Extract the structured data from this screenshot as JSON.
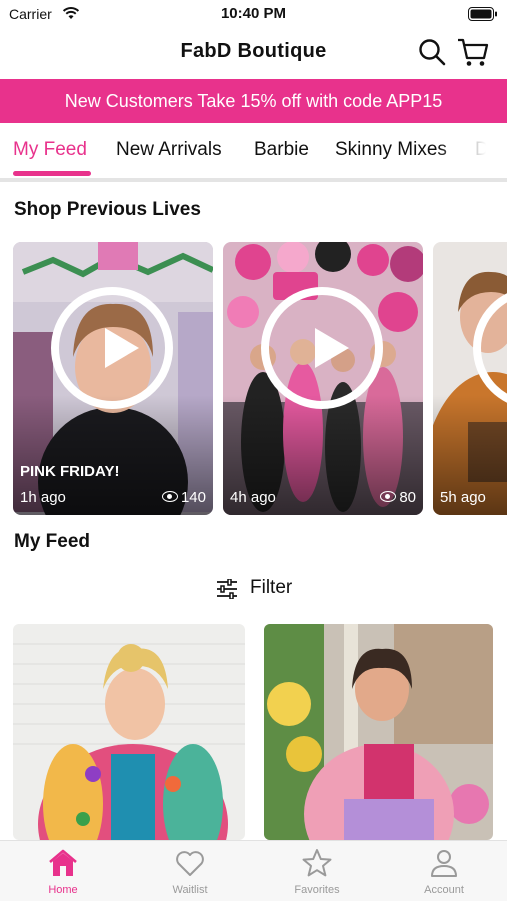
{
  "status_bar": {
    "carrier": "Carrier",
    "time": "10:40 PM"
  },
  "header": {
    "title": "FabD Boutique"
  },
  "promo": {
    "text": "New Customers Take 15% off with code APP15"
  },
  "tabs": [
    {
      "label": "My Feed",
      "active": true
    },
    {
      "label": "New Arrivals"
    },
    {
      "label": "Barbie"
    },
    {
      "label": "Skinny Mixes"
    },
    {
      "label": "D"
    }
  ],
  "lives_section": {
    "title": "Shop Previous Lives"
  },
  "lives": [
    {
      "title": "PINK FRIDAY!",
      "time": "1h ago",
      "views": "140"
    },
    {
      "title": "",
      "time": "4h ago",
      "views": "80"
    },
    {
      "title": "",
      "time": "5h ago",
      "views": ""
    }
  ],
  "feed_section": {
    "title": "My Feed"
  },
  "filter": {
    "label": "Filter"
  },
  "bottom_nav": [
    {
      "label": "Home",
      "icon": "home-icon",
      "active": true
    },
    {
      "label": "Waitlist",
      "icon": "heart-icon"
    },
    {
      "label": "Favorites",
      "icon": "star-icon"
    },
    {
      "label": "Account",
      "icon": "person-icon"
    }
  ],
  "colors": {
    "accent": "#e8328c",
    "inactive": "#9a9a9a"
  }
}
